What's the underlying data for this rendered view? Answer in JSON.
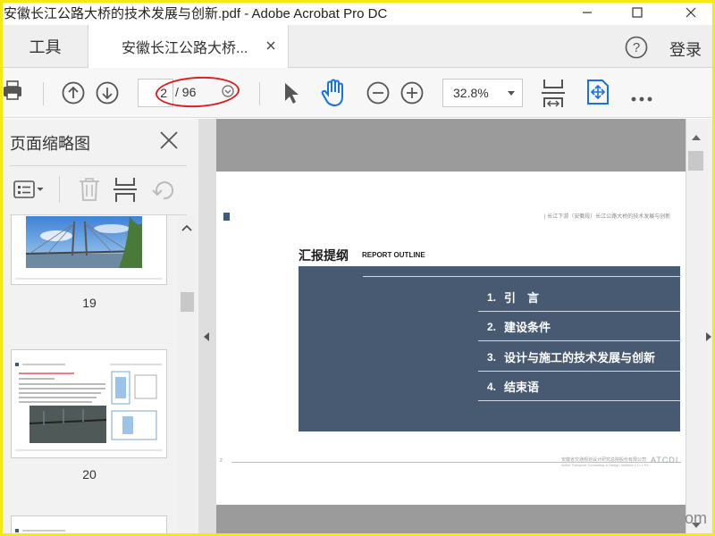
{
  "window": {
    "title": "安徽长江公路大桥的技术发展与创新.pdf - Adobe Acrobat Pro DC"
  },
  "tabs": {
    "tools": "工具",
    "document": "安徽长江公路大桥...",
    "login": "登录"
  },
  "toolbar": {
    "page_current": "2",
    "page_total": "/ 96",
    "zoom": "32.8%"
  },
  "thumbnail_panel": {
    "title": "页面缩略图",
    "pages": [
      {
        "label": "19"
      },
      {
        "label": "20"
      }
    ]
  },
  "slide": {
    "header_text": "| 长江下游（安徽段）长江公路大桥的技术发展与创新",
    "title": "汇报提纲",
    "subtitle": "REPORT OUTLINE",
    "items": [
      {
        "num": "1.",
        "text": "引　言"
      },
      {
        "num": "2.",
        "text": "建设条件"
      },
      {
        "num": "3.",
        "text": "设计与施工的技术发展与创新"
      },
      {
        "num": "4.",
        "text": "结束语"
      }
    ],
    "footer_page": "2",
    "footer_company": "安徽省交通规划设计研究总院股份有限公司",
    "footer_company_en": "Anhui Transport Consulting & Design Institute CO.,LTD",
    "footer_logo": "ATCDI"
  },
  "watermark": "om",
  "colors": {
    "annotation": "#e0201c",
    "slide_panel": "#485a71",
    "acrobat_blue": "#1473e6"
  }
}
